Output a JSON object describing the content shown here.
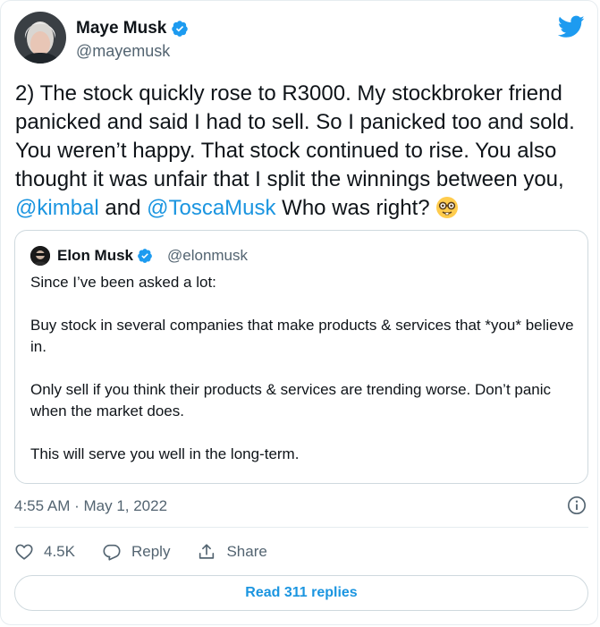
{
  "author": {
    "name": "Maye Musk",
    "handle": "@mayemusk"
  },
  "tweet": {
    "parts": [
      "2) The stock quickly rose to R3000. My stockbroker friend panicked and said I had to sell. So I panicked too and sold. You weren’t happy. That stock continued to rise. You also thought it was unfair that I split the winnings between you, ",
      "@kimbal",
      " and ",
      "@ToscaMusk",
      " Who was right? "
    ],
    "emoji": "nerd-face"
  },
  "quote": {
    "name": "Elon Musk",
    "handle": "@elonmusk",
    "paragraphs": [
      "Since I’ve been asked a lot:",
      "Buy stock in several companies that make products & services that *you* believe in.",
      "Only sell if you think their products & services are trending worse. Don’t panic when the market does.",
      "This will serve you well in the long-term."
    ]
  },
  "meta": {
    "timestamp": "4:55 AM · May 1, 2022"
  },
  "actions": {
    "likes": "4.5K",
    "reply": "Reply",
    "share": "Share"
  },
  "footer": {
    "read_replies": "Read 311 replies"
  },
  "colors": {
    "link": "#1b95e0",
    "verified": "#1d9bf0",
    "muted": "#536471"
  },
  "icons": [
    "verified-badge-icon",
    "twitter-bird-icon",
    "info-icon",
    "heart-icon",
    "reply-icon",
    "share-icon",
    "nerd-face-emoji"
  ]
}
